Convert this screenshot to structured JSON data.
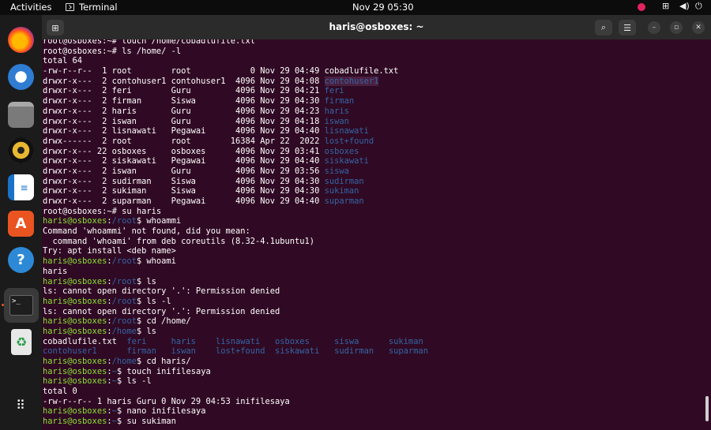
{
  "topbar": {
    "activities": "Activities",
    "app_name": "Terminal",
    "clock": "Nov 29  05:30"
  },
  "dock": {
    "items": [
      "firefox-icon",
      "thunderbird-icon",
      "files-icon",
      "rhythmbox-icon",
      "writer-icon",
      "software-icon",
      "help-icon",
      "terminal-icon",
      "trash-icon",
      "app-grid-icon"
    ]
  },
  "window": {
    "title": "haris@osboxes: ~"
  },
  "terminal": {
    "lines": [
      [
        {
          "t": "root@osboxes:~# touch /home/cobadlufile.txt",
          "c": "w"
        }
      ],
      [
        {
          "t": "root@osboxes:~# ls /home/ -l",
          "c": "w"
        }
      ],
      [
        {
          "t": "total 64",
          "c": "w"
        }
      ],
      [
        {
          "t": "-rw-r--r--  1 root        root            0 Nov 29 04:49 cobadlufile.txt",
          "c": "w"
        }
      ],
      [
        {
          "t": "drwxr-x---  2 contohuser1 contohuser1  4096 Nov 29 04:08 ",
          "c": "w"
        },
        {
          "t": "contohuser1",
          "c": "b hl"
        }
      ],
      [
        {
          "t": "drwxr-x---  2 feri        Guru         4096 Nov 29 04:21 ",
          "c": "w"
        },
        {
          "t": "feri",
          "c": "b"
        }
      ],
      [
        {
          "t": "drwxr-x---  2 firman      Siswa        4096 Nov 29 04:30 ",
          "c": "w"
        },
        {
          "t": "firman",
          "c": "b"
        }
      ],
      [
        {
          "t": "drwxr-x---  2 haris       Guru         4096 Nov 29 04:23 ",
          "c": "w"
        },
        {
          "t": "haris",
          "c": "b"
        }
      ],
      [
        {
          "t": "drwxr-x---  2 iswan       Guru         4096 Nov 29 04:18 ",
          "c": "w"
        },
        {
          "t": "iswan",
          "c": "b"
        }
      ],
      [
        {
          "t": "drwxr-x---  2 lisnawati   Pegawai      4096 Nov 29 04:40 ",
          "c": "w"
        },
        {
          "t": "lisnawati",
          "c": "b"
        }
      ],
      [
        {
          "t": "drwx------  2 root        root        16384 Apr 22  2022 ",
          "c": "w"
        },
        {
          "t": "lost+found",
          "c": "b"
        }
      ],
      [
        {
          "t": "drwxr-x--- 22 osboxes     osboxes      4096 Nov 29 03:41 ",
          "c": "w"
        },
        {
          "t": "osboxes",
          "c": "b"
        }
      ],
      [
        {
          "t": "drwxr-x---  2 siskawati   Pegawai      4096 Nov 29 04:40 ",
          "c": "w"
        },
        {
          "t": "siskawati",
          "c": "b"
        }
      ],
      [
        {
          "t": "drwxr-x---  2 iswan       Guru         4096 Nov 29 03:56 ",
          "c": "w"
        },
        {
          "t": "siswa",
          "c": "b"
        }
      ],
      [
        {
          "t": "drwxr-x---  2 sudirman    Siswa        4096 Nov 29 04:30 ",
          "c": "w"
        },
        {
          "t": "sudirman",
          "c": "b"
        }
      ],
      [
        {
          "t": "drwxr-x---  2 sukiman     Siswa        4096 Nov 29 04:30 ",
          "c": "w"
        },
        {
          "t": "sukiman",
          "c": "b"
        }
      ],
      [
        {
          "t": "drwxr-x---  2 suparman    Pegawai      4096 Nov 29 04:40 ",
          "c": "w"
        },
        {
          "t": "suparman",
          "c": "b"
        }
      ],
      [
        {
          "t": "root@osboxes:~# su haris",
          "c": "w"
        }
      ],
      [
        {
          "t": "haris@osboxes",
          "c": "g"
        },
        {
          "t": ":",
          "c": "w"
        },
        {
          "t": "/root",
          "c": "b"
        },
        {
          "t": "$ whoammi",
          "c": "w"
        }
      ],
      [
        {
          "t": "Command 'whoammi' not found, did you mean:",
          "c": "w"
        }
      ],
      [
        {
          "t": "  command 'whoami' from deb coreutils (8.32-4.1ubuntu1)",
          "c": "w"
        }
      ],
      [
        {
          "t": "Try: apt install <deb name>",
          "c": "w"
        }
      ],
      [
        {
          "t": "haris@osboxes",
          "c": "g"
        },
        {
          "t": ":",
          "c": "w"
        },
        {
          "t": "/root",
          "c": "b"
        },
        {
          "t": "$ whoami",
          "c": "w"
        }
      ],
      [
        {
          "t": "haris",
          "c": "w"
        }
      ],
      [
        {
          "t": "haris@osboxes",
          "c": "g"
        },
        {
          "t": ":",
          "c": "w"
        },
        {
          "t": "/root",
          "c": "b"
        },
        {
          "t": "$ ls",
          "c": "w"
        }
      ],
      [
        {
          "t": "ls: cannot open directory '.': Permission denied",
          "c": "w"
        }
      ],
      [
        {
          "t": "haris@osboxes",
          "c": "g"
        },
        {
          "t": ":",
          "c": "w"
        },
        {
          "t": "/root",
          "c": "b"
        },
        {
          "t": "$ ls -l",
          "c": "w"
        }
      ],
      [
        {
          "t": "ls: cannot open directory '.': Permission denied",
          "c": "w"
        }
      ],
      [
        {
          "t": "haris@osboxes",
          "c": "g"
        },
        {
          "t": ":",
          "c": "w"
        },
        {
          "t": "/root",
          "c": "b"
        },
        {
          "t": "$ cd /home/",
          "c": "w"
        }
      ],
      [
        {
          "t": "haris@osboxes",
          "c": "g"
        },
        {
          "t": ":",
          "c": "w"
        },
        {
          "t": "/home",
          "c": "b"
        },
        {
          "t": "$ ls",
          "c": "w"
        }
      ],
      [
        {
          "t": "cobadlufile.txt  ",
          "c": "w"
        },
        {
          "t": "feri     haris    lisnawati   osboxes     siswa      sukiman",
          "c": "b"
        }
      ],
      [
        {
          "t": "contohuser1      firman   iswan    lost+found  siskawati   sudirman   suparman",
          "c": "b"
        }
      ],
      [
        {
          "t": "haris@osboxes",
          "c": "g"
        },
        {
          "t": ":",
          "c": "w"
        },
        {
          "t": "/home",
          "c": "b"
        },
        {
          "t": "$ cd haris/",
          "c": "w"
        }
      ],
      [
        {
          "t": "haris@osboxes",
          "c": "g"
        },
        {
          "t": ":",
          "c": "w"
        },
        {
          "t": "~",
          "c": "b"
        },
        {
          "t": "$ touch inifilesaya",
          "c": "w"
        }
      ],
      [
        {
          "t": "haris@osboxes",
          "c": "g"
        },
        {
          "t": ":",
          "c": "w"
        },
        {
          "t": "~",
          "c": "b"
        },
        {
          "t": "$ ls -l",
          "c": "w"
        }
      ],
      [
        {
          "t": "total 0",
          "c": "w"
        }
      ],
      [
        {
          "t": "-rw-r--r-- 1 haris Guru 0 Nov 29 04:53 inifilesaya",
          "c": "w"
        }
      ],
      [
        {
          "t": "haris@osboxes",
          "c": "g"
        },
        {
          "t": ":",
          "c": "w"
        },
        {
          "t": "~",
          "c": "b"
        },
        {
          "t": "$ nano inifilesaya",
          "c": "w"
        }
      ],
      [
        {
          "t": "haris@osboxes",
          "c": "g"
        },
        {
          "t": ":",
          "c": "w"
        },
        {
          "t": "~",
          "c": "b"
        },
        {
          "t": "$ su sukiman",
          "c": "w"
        }
      ]
    ]
  }
}
